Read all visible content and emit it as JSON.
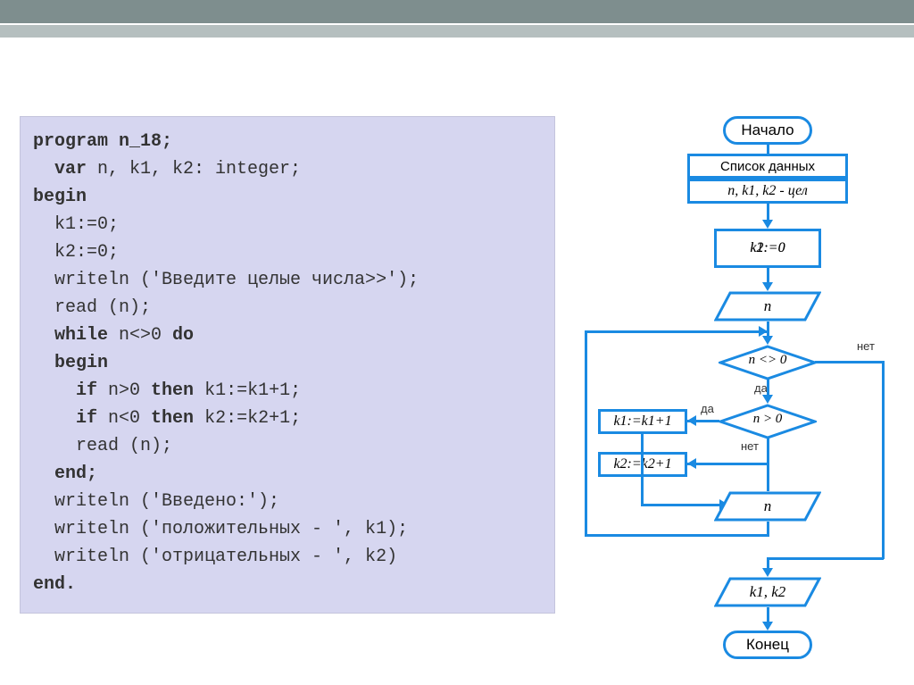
{
  "code": {
    "l1": "program n_18;",
    "l2": "  var n, k1, k2: integer;",
    "l3": "begin",
    "l4": "  k1:=0;",
    "l5": "  k2:=0;",
    "l6": "  writeln ('Введите целые числа>>');",
    "l7": "  read (n);",
    "l8": "  while n<>0 do",
    "l9": "  begin",
    "l10": "    if n>0 then k1:=k1+1;",
    "l11": "    if n<0 then k2:=k2+1;",
    "l12": "    read (n);",
    "l13": "  end;",
    "l14": "  writeln ('Введено:');",
    "l15": "  writeln ('положительных - ', k1);",
    "l16": "  writeln ('отрицательных - ', k2)",
    "l17": "end."
  },
  "flow": {
    "start": "Начало",
    "datalist": "Список данных",
    "vars": "n, k1, k2 - цел",
    "init1": "k1:=0",
    "init2": "k2:=0",
    "io_n1": "n",
    "cond1": "n <> 0",
    "cond2": "n > 0",
    "assign1": "k1:=k1+1",
    "assign2": "k2:=k2+1",
    "io_n2": "n",
    "io_out": "k1, k2",
    "end": "Конец",
    "yes": "да",
    "no": "нет"
  }
}
